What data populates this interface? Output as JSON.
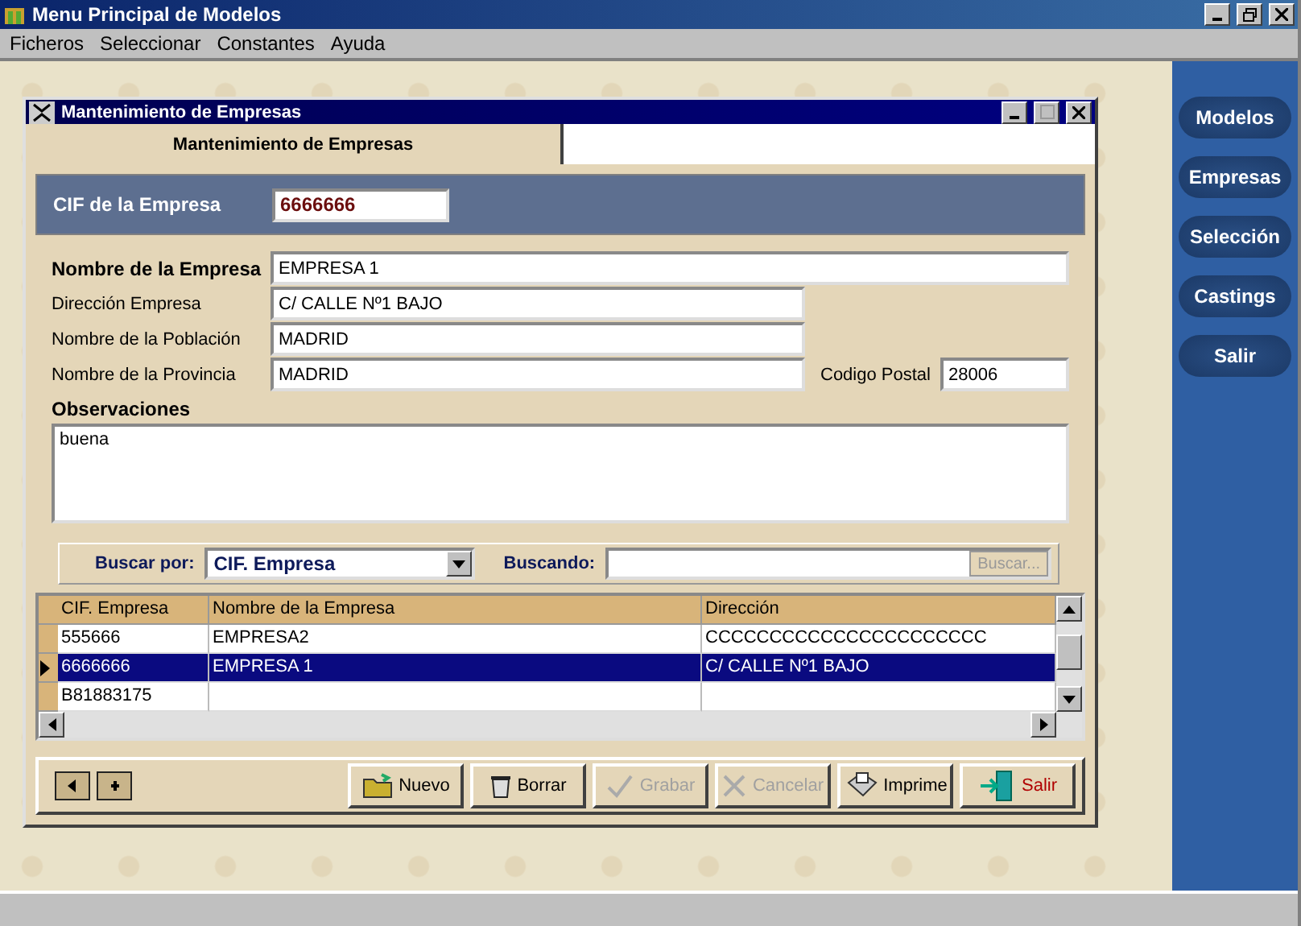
{
  "window": {
    "title": "Menu Principal de Modelos"
  },
  "menu": [
    "Ficheros",
    "Seleccionar",
    "Constantes",
    "Ayuda"
  ],
  "child_window": {
    "title": "Mantenimiento de Empresas"
  },
  "tabs": [
    {
      "label": "Mantenimiento de Empresas",
      "selected": true
    }
  ],
  "cif": {
    "label": "CIF de la Empresa",
    "value": "6666666"
  },
  "fields": [
    {
      "label": "Nombre de la Empresa",
      "value": "EMPRESA 1",
      "emphasized": true,
      "kind": "full"
    },
    {
      "label": "Dirección Empresa",
      "value": "C/ CALLE Nº1 BAJO",
      "emphasized": false,
      "kind": "half"
    },
    {
      "label": "Nombre de la Población",
      "value": "MADRID",
      "emphasized": false,
      "kind": "half"
    },
    {
      "label": "Nombre de la Provincia",
      "value": "MADRID",
      "emphasized": false,
      "kind": "half"
    }
  ],
  "postal": {
    "label": "Codigo Postal",
    "value": "28006"
  },
  "notes": {
    "label": "Observaciones",
    "value": "buena"
  },
  "search": {
    "by_label": "Buscar por:",
    "by_value": "CIF. Empresa",
    "text_label": "Buscando:",
    "button": "Buscar...",
    "button_disabled": true
  },
  "grid": {
    "columns": [
      "CIF. Empresa",
      "Nombre de la Empresa",
      "Dirección"
    ],
    "rows": [
      {
        "cells": [
          "555666",
          "EMPRESA2",
          "CCCCCCCCCCCCCCCCCCCCCC"
        ],
        "selected": false
      },
      {
        "cells": [
          "6666666",
          "EMPRESA 1",
          "C/ CALLE Nº1 BAJO"
        ],
        "selected": true
      },
      {
        "cells": [
          "B81883175",
          "",
          ""
        ],
        "selected": false
      }
    ]
  },
  "buttons": [
    {
      "label": "Nuevo",
      "kind": "new",
      "disabled": false
    },
    {
      "label": "Borrar",
      "kind": "delete",
      "disabled": false
    },
    {
      "label": "Grabar",
      "kind": "save",
      "disabled": true
    },
    {
      "label": "Cancelar",
      "kind": "cancel",
      "disabled": true
    },
    {
      "label": "Imprime",
      "kind": "print",
      "disabled": false
    },
    {
      "label": "Salir",
      "kind": "exit",
      "disabled": false
    }
  ],
  "sidebar": [
    "Modelos",
    "Empresas",
    "Selección",
    "Castings",
    "Salir"
  ]
}
